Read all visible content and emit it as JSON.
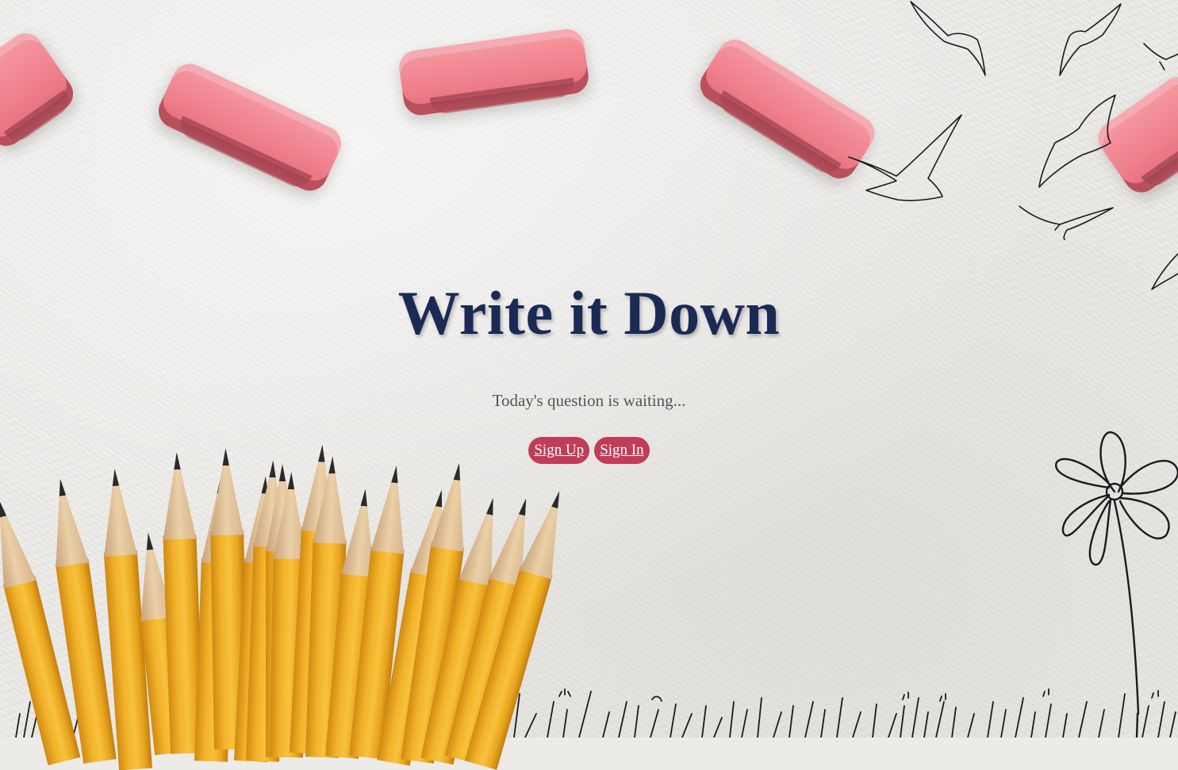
{
  "app": {
    "title": "Write it Down",
    "subtitle": "Today's question is waiting..."
  },
  "actions": {
    "sign_up_label": "Sign Up",
    "sign_in_label": "Sign In"
  },
  "colors": {
    "title": "#1b2a55",
    "button_bg": "#c23b58",
    "button_text": "#ffffff",
    "subtitle": "#555555",
    "paper": "#ebeae7"
  },
  "decor": {
    "erasers_icon": "eraser-illustration",
    "pencils_icon": "pencil-bundle-illustration",
    "birds_icon": "seagull-sketch",
    "flower_icon": "flower-sketch",
    "grass_icon": "grass-sketch"
  }
}
